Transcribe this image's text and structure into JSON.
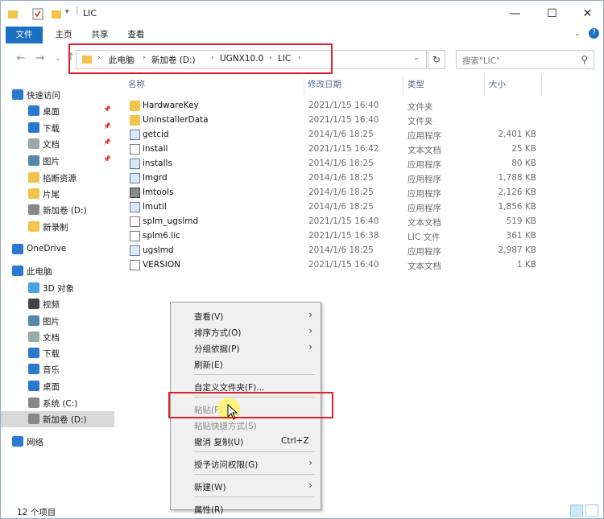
{
  "window": {
    "title": "LIC",
    "controls": {
      "minimize": "—",
      "maximize": "☐",
      "close": "✕"
    }
  },
  "ribbon": {
    "tabs": [
      "文件",
      "主页",
      "共享",
      "查看"
    ]
  },
  "address": {
    "crumbs": [
      "此电脑",
      "新加卷 (D:)",
      "UGNX10.0",
      "LIC"
    ],
    "search_placeholder": "搜索\"LIC\""
  },
  "nav": {
    "items": [
      {
        "label": "快速访问",
        "icon": "star-icon"
      },
      {
        "label": "桌面",
        "icon": "desktop-icon",
        "pinned": true
      },
      {
        "label": "下载",
        "icon": "download-icon",
        "pinned": true
      },
      {
        "label": "文档",
        "icon": "document-icon",
        "pinned": true
      },
      {
        "label": "图片",
        "icon": "picture-icon",
        "pinned": true
      },
      {
        "label": "掐断资源",
        "icon": "folder-icon"
      },
      {
        "label": "片尾",
        "icon": "folder-icon"
      },
      {
        "label": "新加卷 (D:)",
        "icon": "drive-icon"
      },
      {
        "label": "新录制",
        "icon": "folder-icon"
      },
      {
        "label": "OneDrive",
        "icon": "cloud-icon"
      },
      {
        "label": "此电脑",
        "icon": "computer-icon"
      },
      {
        "label": "3D 对象",
        "icon": "cube-icon"
      },
      {
        "label": "视频",
        "icon": "video-icon"
      },
      {
        "label": "图片",
        "icon": "picture-icon"
      },
      {
        "label": "文档",
        "icon": "document-icon"
      },
      {
        "label": "下载",
        "icon": "download-icon"
      },
      {
        "label": "音乐",
        "icon": "music-icon"
      },
      {
        "label": "桌面",
        "icon": "desktop-icon"
      },
      {
        "label": "系统 (C:)",
        "icon": "drive-icon"
      },
      {
        "label": "新加卷 (D:)",
        "icon": "drive-icon"
      },
      {
        "label": "网络",
        "icon": "network-icon"
      }
    ]
  },
  "columns": [
    "名称",
    "修改日期",
    "类型",
    "大小"
  ],
  "files": [
    {
      "name": "HardwareKey",
      "date": "2021/1/15 16:40",
      "type": "文件夹",
      "size": "",
      "icon": "folder"
    },
    {
      "name": "UninstallerData",
      "date": "2021/1/15 16:40",
      "type": "文件夹",
      "size": "",
      "icon": "folder"
    },
    {
      "name": "getcid",
      "date": "2014/1/6 18:25",
      "type": "应用程序",
      "size": "2,401 KB",
      "icon": "exe"
    },
    {
      "name": "install",
      "date": "2021/1/15 16:42",
      "type": "文本文档",
      "size": "25 KB",
      "icon": "doc"
    },
    {
      "name": "installs",
      "date": "2014/1/6 18:25",
      "type": "应用程序",
      "size": "80 KB",
      "icon": "exe"
    },
    {
      "name": "lmgrd",
      "date": "2014/1/6 18:25",
      "type": "应用程序",
      "size": "1,788 KB",
      "icon": "exe"
    },
    {
      "name": "lmtools",
      "date": "2014/1/6 18:25",
      "type": "应用程序",
      "size": "2,126 KB",
      "icon": "tool"
    },
    {
      "name": "lmutil",
      "date": "2014/1/6 18:25",
      "type": "应用程序",
      "size": "1,856 KB",
      "icon": "exe"
    },
    {
      "name": "splm_ugslmd",
      "date": "2021/1/15 16:40",
      "type": "文本文档",
      "size": "519 KB",
      "icon": "doc"
    },
    {
      "name": "splm6.lic",
      "date": "2021/1/15 16:38",
      "type": "LIC 文件",
      "size": "361 KB",
      "icon": "doc"
    },
    {
      "name": "ugslmd",
      "date": "2014/1/6 18:25",
      "type": "应用程序",
      "size": "2,987 KB",
      "icon": "exe"
    },
    {
      "name": "VERSION",
      "date": "2021/1/15 16:40",
      "type": "文本文档",
      "size": "1 KB",
      "icon": "doc"
    }
  ],
  "context_menu": {
    "items": [
      {
        "label": "查看(V)",
        "submenu": true
      },
      {
        "label": "排序方式(O)",
        "submenu": true
      },
      {
        "label": "分组依据(P)",
        "submenu": true
      },
      {
        "label": "刷新(E)"
      },
      {
        "sep": true
      },
      {
        "label": "自定义文件夹(F)..."
      },
      {
        "sep": true
      },
      {
        "label": "粘贴(P)",
        "disabled": true
      },
      {
        "label": "粘贴快捷方式(S)",
        "disabled": true
      },
      {
        "label": "撤消 复制(U)",
        "shortcut": "Ctrl+Z"
      },
      {
        "sep": true
      },
      {
        "label": "授予访问权限(G)",
        "submenu": true
      },
      {
        "sep": true
      },
      {
        "label": "新建(W)",
        "submenu": true
      },
      {
        "sep": true
      },
      {
        "label": "属性(R)"
      }
    ]
  },
  "status": {
    "count": "12 个项目"
  },
  "colors": {
    "accent": "#1a6fc2",
    "highlight": "#e0202a"
  }
}
